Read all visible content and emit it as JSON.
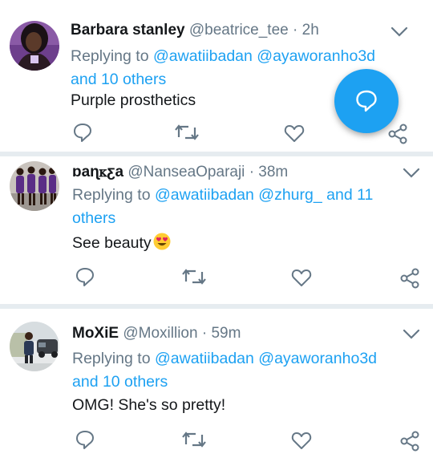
{
  "tweets": [
    {
      "name": "Barbara stanley",
      "handle": "@beatrice_tee",
      "separator": "·",
      "time": "2h",
      "replying_prefix": "Replying to",
      "mention1": "@awatiibadan",
      "mention2": "@ayaworanho3d",
      "replying_rest": "and 10 others",
      "text": "Purple prosthetics"
    },
    {
      "name": "ɒaɳꮶƹa",
      "handle": "@NanseaOparaji",
      "separator": "·",
      "time": "38m",
      "replying_prefix": "Replying to",
      "mention1": "@awatiibadan",
      "mention2": "@zhurg_",
      "replying_and": "and 11",
      "replying_rest": "others",
      "text": "See beauty",
      "emoji": "heart-eyes-emoji"
    },
    {
      "name": "MoXiE",
      "handle": "@Moxillion",
      "separator": "·",
      "time": "59m",
      "replying_prefix": "Replying to",
      "mention1": "@awatiibadan",
      "mention2": "@ayaworanho3d",
      "replying_rest": "and 10 others",
      "text": "OMG! She's so pretty!"
    }
  ],
  "icons": {
    "reply": "reply-icon",
    "retweet": "retweet-icon",
    "like": "heart-icon",
    "share": "share-icon",
    "more": "chevron-down-icon",
    "compose": "compose-reply-icon"
  },
  "colors": {
    "brand_blue": "#1da1f2",
    "secondary_text": "#657786",
    "primary_text": "#14171a",
    "divider": "#e6ecf0"
  }
}
